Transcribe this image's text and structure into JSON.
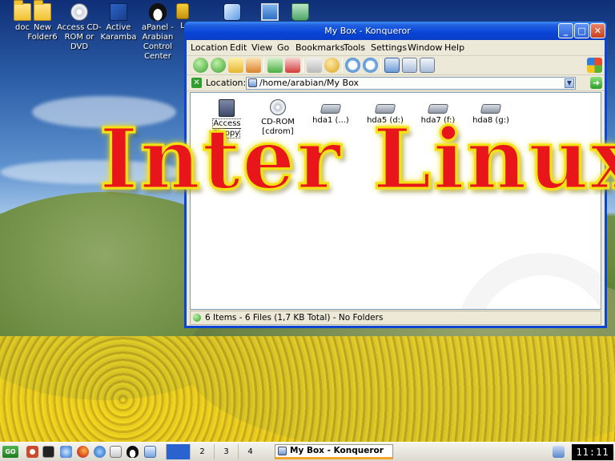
{
  "desktop": {
    "icons": [
      {
        "label": "doc",
        "icon": "folder-icon"
      },
      {
        "label": "New Folder6",
        "icon": "folder-icon"
      },
      {
        "label": "Access CD-ROM or DVD",
        "icon": "cdrom-icon"
      },
      {
        "label": "Active Karamba",
        "icon": "karamba-icon"
      },
      {
        "label": "aPanel - Arabian Control Center",
        "icon": "tux-icon"
      },
      {
        "label": "L",
        "icon": "lock-icon"
      },
      {
        "label": "",
        "icon": "network-icon"
      },
      {
        "label": "",
        "icon": "monitor-icon"
      },
      {
        "label": "",
        "icon": "trash-icon"
      }
    ]
  },
  "overlay_text": "Inter Linux",
  "window": {
    "title": "My Box - Konqueror",
    "menu": [
      "Location",
      "Edit",
      "View",
      "Go",
      "Bookmarks",
      "Tools",
      "Settings",
      "Window",
      "Help"
    ],
    "location_label": "Location:",
    "location_value": "/home/arabian/My Box",
    "files": [
      {
        "label": "Access Floppy",
        "icon": "floppy-icon"
      },
      {
        "label": "CD-ROM [cdrom]",
        "icon": "cdrom-icon"
      },
      {
        "label": "hda1 (...)",
        "icon": "hdd-icon"
      },
      {
        "label": "hda5 (d:)",
        "icon": "hdd-icon"
      },
      {
        "label": "hda7 (f:)",
        "icon": "hdd-icon"
      },
      {
        "label": "hda8 (g:)",
        "icon": "hdd-icon"
      }
    ],
    "status": "6 Items - 6 Files (1,7 KB Total) - No Folders"
  },
  "taskbar": {
    "pager": [
      "2",
      "3",
      "4"
    ],
    "active_task": "My Box - Konqueror",
    "clock": "11:11"
  },
  "colors": {
    "title_bar": "#0a45d8",
    "overlay_text": "#e8151a",
    "overlay_outline": "#f6e214"
  }
}
